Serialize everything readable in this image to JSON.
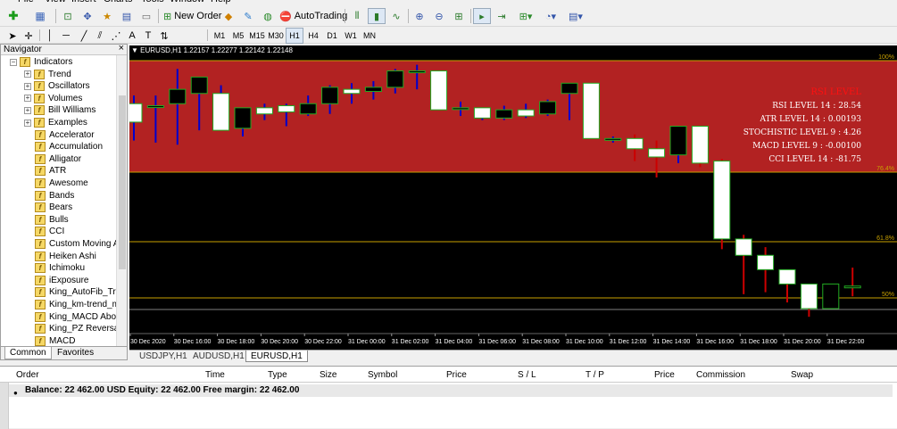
{
  "menubar": {
    "items": [
      "File",
      "View",
      "Insert",
      "Charts",
      "Tools",
      "Window",
      "Help"
    ]
  },
  "toolbar": {
    "new_order_label": "New Order",
    "autotrading_label": "AutoTrading",
    "timeframes": [
      "M1",
      "M5",
      "M15",
      "M30",
      "H1",
      "H4",
      "D1",
      "W1",
      "MN"
    ],
    "active_timeframe": "H1"
  },
  "navigator": {
    "title": "Navigator",
    "close_label": "×",
    "root": "Indicators",
    "groups": [
      "Trend",
      "Oscillators",
      "Volumes",
      "Bill Williams",
      "Examples"
    ],
    "items": [
      "Accelerator",
      "Accumulation",
      "Alligator",
      "ATR",
      "Awesome",
      "Bands",
      "Bears",
      "Bulls",
      "CCI",
      "Custom Moving Averages",
      "Heiken Ashi",
      "Ichimoku",
      "iExposure",
      "King_AutoFib_Tradin",
      "King_km-trend_m",
      "King_MACD Above",
      "King_PZ Reversal",
      "MACD"
    ],
    "tabs": [
      "Common",
      "Favorites"
    ],
    "active_tab": "Common"
  },
  "chart": {
    "title": "EURUSD,H1  1.22157 1.22277 1.22142 1.22148",
    "colors": {
      "zone": "#b22222",
      "fib_line": "#c8a000",
      "price_line": "#808080",
      "bull": "#ffffff",
      "bear": "#000000",
      "wick_up": "#0000cc",
      "wick_down": "#cc0000",
      "edge": "#22aa22"
    },
    "indicator_title": "RSI LEVEL",
    "indicators": [
      "RSI LEVEL 14 : 28.54",
      "ATR LEVEL 14 : 0.00193",
      "STOCHISTIC LEVEL 9 : 4.26",
      "MACD LEVEL 9 : -0.00100",
      "CCI LEVEL 14 : -81.75"
    ],
    "fib_levels": [
      "100%",
      "76.4%",
      "61.8%",
      "50%"
    ],
    "time_labels": [
      "30 Dec 2020",
      "30 Dec 16:00",
      "30 Dec 18:00",
      "30 Dec 20:00",
      "30 Dec 22:00",
      "31 Dec 00:00",
      "31 Dec 02:00",
      "31 Dec 04:00",
      "31 Dec 06:00",
      "31 Dec 08:00",
      "31 Dec 10:00",
      "31 Dec 12:00",
      "31 Dec 14:00",
      "31 Dec 16:00",
      "31 Dec 18:00",
      "31 Dec 20:00",
      "31 Dec 22:00"
    ],
    "candles": [
      {
        "o": 1.2281,
        "h": 1.2285,
        "l": 1.2263,
        "c": 1.2272
      },
      {
        "o": 1.228,
        "h": 1.2285,
        "l": 1.2262,
        "c": 1.228
      },
      {
        "o": 1.2281,
        "h": 1.2298,
        "l": 1.2261,
        "c": 1.2288
      },
      {
        "o": 1.2286,
        "h": 1.2294,
        "l": 1.2268,
        "c": 1.2294
      },
      {
        "o": 1.2286,
        "h": 1.229,
        "l": 1.2268,
        "c": 1.2268
      },
      {
        "o": 1.2269,
        "h": 1.2279,
        "l": 1.2265,
        "c": 1.2279
      },
      {
        "o": 1.2279,
        "h": 1.2281,
        "l": 1.2273,
        "c": 1.2276
      },
      {
        "o": 1.228,
        "h": 1.2281,
        "l": 1.227,
        "c": 1.2277
      },
      {
        "o": 1.2276,
        "h": 1.2285,
        "l": 1.2275,
        "c": 1.2281
      },
      {
        "o": 1.2281,
        "h": 1.229,
        "l": 1.2276,
        "c": 1.2289
      },
      {
        "o": 1.2288,
        "h": 1.2291,
        "l": 1.2281,
        "c": 1.2286
      },
      {
        "o": 1.2287,
        "h": 1.2292,
        "l": 1.2283,
        "c": 1.2289
      },
      {
        "o": 1.2289,
        "h": 1.2298,
        "l": 1.2286,
        "c": 1.2297
      },
      {
        "o": 1.2297,
        "h": 1.23,
        "l": 1.2288,
        "c": 1.2297
      },
      {
        "o": 1.2297,
        "h": 1.2297,
        "l": 1.2278,
        "c": 1.2278
      },
      {
        "o": 1.2279,
        "h": 1.2282,
        "l": 1.2275,
        "c": 1.2279
      },
      {
        "o": 1.2279,
        "h": 1.2279,
        "l": 1.2273,
        "c": 1.2274
      },
      {
        "o": 1.2274,
        "h": 1.228,
        "l": 1.2273,
        "c": 1.2278
      },
      {
        "o": 1.2278,
        "h": 1.2281,
        "l": 1.2274,
        "c": 1.2275
      },
      {
        "o": 1.2276,
        "h": 1.2283,
        "l": 1.2275,
        "c": 1.2282
      },
      {
        "o": 1.2286,
        "h": 1.2291,
        "l": 1.2273,
        "c": 1.2291
      },
      {
        "o": 1.2291,
        "h": 1.2291,
        "l": 1.2264,
        "c": 1.2264
      },
      {
        "o": 1.2264,
        "h": 1.2265,
        "l": 1.2262,
        "c": 1.2264
      },
      {
        "o": 1.2264,
        "h": 1.2266,
        "l": 1.2253,
        "c": 1.2259
      },
      {
        "o": 1.2259,
        "h": 1.2263,
        "l": 1.2245,
        "c": 1.2255
      },
      {
        "o": 1.2256,
        "h": 1.227,
        "l": 1.2252,
        "c": 1.227
      },
      {
        "o": 1.227,
        "h": 1.227,
        "l": 1.225,
        "c": 1.2252
      },
      {
        "o": 1.2253,
        "h": 1.2254,
        "l": 1.221,
        "c": 1.2215
      },
      {
        "o": 1.2215,
        "h": 1.2217,
        "l": 1.2188,
        "c": 1.2207
      },
      {
        "o": 1.2207,
        "h": 1.2211,
        "l": 1.2189,
        "c": 1.22
      },
      {
        "o": 1.22,
        "h": 1.22,
        "l": 1.2184,
        "c": 1.2193
      },
      {
        "o": 1.2193,
        "h": 1.219,
        "l": 1.2177,
        "c": 1.2181
      },
      {
        "o": 1.2181,
        "h": 1.219,
        "l": 1.2181,
        "c": 1.2193
      },
      {
        "o": 1.2192,
        "h": 1.2201,
        "l": 1.2187,
        "c": 1.2192
      }
    ]
  },
  "chart_tabs": [
    "USDJPY,H1",
    "AUDUSD,H1",
    "EURUSD,H1"
  ],
  "active_chart_tab": "EURUSD,H1",
  "terminal": {
    "columns": [
      "Order",
      "Time",
      "Type",
      "Size",
      "Symbol",
      "Price",
      "S / L",
      "T / P",
      "Price",
      "Commission",
      "Swap"
    ],
    "balance_text": "Balance: 22 462.00 USD  Equity: 22 462.00  Free margin: 22 462.00"
  }
}
